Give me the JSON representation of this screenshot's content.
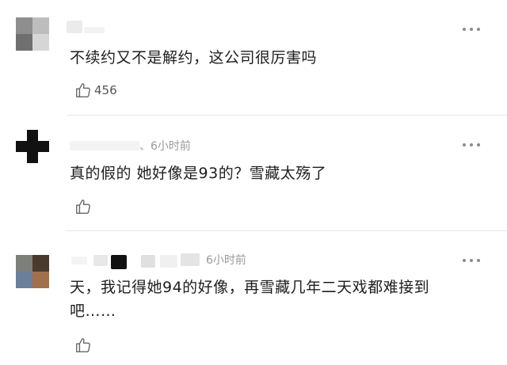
{
  "comments": [
    {
      "timestamp": "",
      "text": "不续约又不是解约，这公司很厉害吗",
      "like_count": "456"
    },
    {
      "timestamp": "、6小时前",
      "text": "真的假的 她好像是93的？雪藏太殇了",
      "like_count": ""
    },
    {
      "timestamp": "6小时前",
      "text": "天，我记得她94的好像，再雪藏几年二天戏都难接到吧……",
      "like_count": ""
    }
  ],
  "icons": {
    "like": "thumbs-up-outline",
    "more": "three-dots-horizontal"
  },
  "colors": {
    "text": "#1e1e1e",
    "meta": "#999999",
    "divider": "#e6e6e6",
    "icon": "#666666"
  }
}
